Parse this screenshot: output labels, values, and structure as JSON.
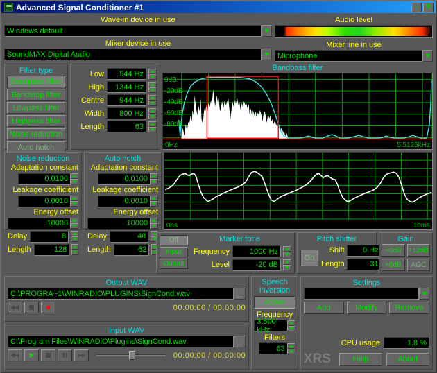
{
  "window": {
    "title": "Advanced Signal Conditioner #1",
    "minimize_label": "–",
    "close_label": "✕"
  },
  "devices": {
    "wave_in_caption": "Wave-in device in use",
    "wave_in_value": "Windows default",
    "mixer_caption": "Mixer device in use",
    "mixer_value": "SoundMAX Digital Audio",
    "audio_level_caption": "Audio level",
    "mixer_line_caption": "Mixer line in use",
    "mixer_line_value": "Microphone"
  },
  "filter_type": {
    "caption": "Filter type",
    "items": [
      {
        "label": "Bandpass filter",
        "selected": true,
        "disabled": false
      },
      {
        "label": "Bandstop filter",
        "selected": false,
        "disabled": false
      },
      {
        "label": "Lowpass filter",
        "selected": false,
        "disabled": false
      },
      {
        "label": "Highpass filter",
        "selected": false,
        "disabled": false
      },
      {
        "label": "Noise reduction",
        "selected": false,
        "disabled": false
      },
      {
        "label": "Auto notch",
        "selected": false,
        "disabled": true
      }
    ]
  },
  "filter_params": [
    {
      "label": "Low",
      "value": "544  Hz"
    },
    {
      "label": "High",
      "value": "1344  Hz"
    },
    {
      "label": "Centre",
      "value": "944  Hz"
    },
    {
      "label": "Width",
      "value": "800  Hz"
    },
    {
      "label": "Length",
      "value": "63"
    }
  ],
  "noise_reduction": {
    "caption": "Noise reduction",
    "adaptation_label": "Adaptation constant",
    "adaptation_value": "0.0100",
    "leakage_label": "Leakage coefficient",
    "leakage_value": "0.0010",
    "energy_label": "Energy offset",
    "energy_value": "10000",
    "delay_label": "Delay",
    "delay_value": "8",
    "length_label": "Length",
    "length_value": "128"
  },
  "auto_notch": {
    "caption": "Auto notch",
    "adaptation_label": "Adaptation constant",
    "adaptation_value": "0.0100",
    "leakage_label": "Leakage coefficient",
    "leakage_value": "0.0010",
    "energy_label": "Energy offset",
    "energy_value": "10000",
    "delay_label": "Delay",
    "delay_value": "48",
    "length_label": "Length",
    "length_value": "62"
  },
  "marker_tone": {
    "caption": "Marker tone",
    "modes": [
      {
        "label": "Off",
        "selected": true
      },
      {
        "label": "Input",
        "selected": false
      },
      {
        "label": "Output",
        "selected": false
      }
    ],
    "frequency_label": "Frequency",
    "frequency_value": "1000  Hz",
    "level_label": "Level",
    "level_value": "-20  dB"
  },
  "pitch_shifter": {
    "caption": "Pitch shifter",
    "on_label": "On",
    "on_selected": true,
    "shift_label": "Shift",
    "shift_value": "0 Hz",
    "length_label": "Length",
    "length_value": "31"
  },
  "gain": {
    "caption": "Gain",
    "buttons": [
      {
        "label": "+0dB",
        "disabled": false
      },
      {
        "label": "+12dB",
        "disabled": false
      },
      {
        "label": "+6dB",
        "disabled": false
      },
      {
        "label": "AGC",
        "disabled": true
      }
    ]
  },
  "output_wav": {
    "caption": "Output WAV",
    "path": "C:\\PROGRA~1\\WINRADIO\\PLUGINS\\SignCond.wav",
    "browse_label": "...",
    "elapsed": "00:00:00",
    "separator": "/",
    "total": "00:00:00"
  },
  "input_wav": {
    "caption": "Input WAV",
    "path": "C:\\Program Files\\WiNRADiO\\Plugins\\SignCond.wav",
    "browse_label": "...",
    "elapsed": "00:00:00",
    "separator": "/",
    "total": "00:00:00"
  },
  "speech_inversion": {
    "title_line1": "Speech",
    "title_line2": "inversion",
    "active_label": "Active",
    "frequency_label": "Frequency",
    "frequency_value": "3.500 kHz",
    "filters_length_label": "Filters length",
    "filters_length_value": "63"
  },
  "settings": {
    "caption": "Settings",
    "value": "",
    "add_label": "Add",
    "modify_label": "Modify",
    "remove_label": "Remove"
  },
  "status": {
    "cpu_label": "CPU usage",
    "cpu_value": "1.8 %",
    "brand": "XRS",
    "help_label": "Help",
    "about_label": "About"
  },
  "spectrum": {
    "title": "Bandpass filter",
    "y_ticks": [
      "0dB",
      "-20dB",
      "-40dB",
      "-60dB",
      "-80dB"
    ],
    "x_min_label": "0Hz",
    "x_max_label": "5.5125kHz",
    "curve_color": "#40e0e8",
    "fill_color": "#ffffff",
    "marker_color": "#ff0000",
    "grid_color": "#00a000"
  },
  "waveform": {
    "x_min_label": "0ns",
    "x_max_label": "10ms",
    "trace_color": "#ffffff",
    "grid_color": "#00a000"
  }
}
